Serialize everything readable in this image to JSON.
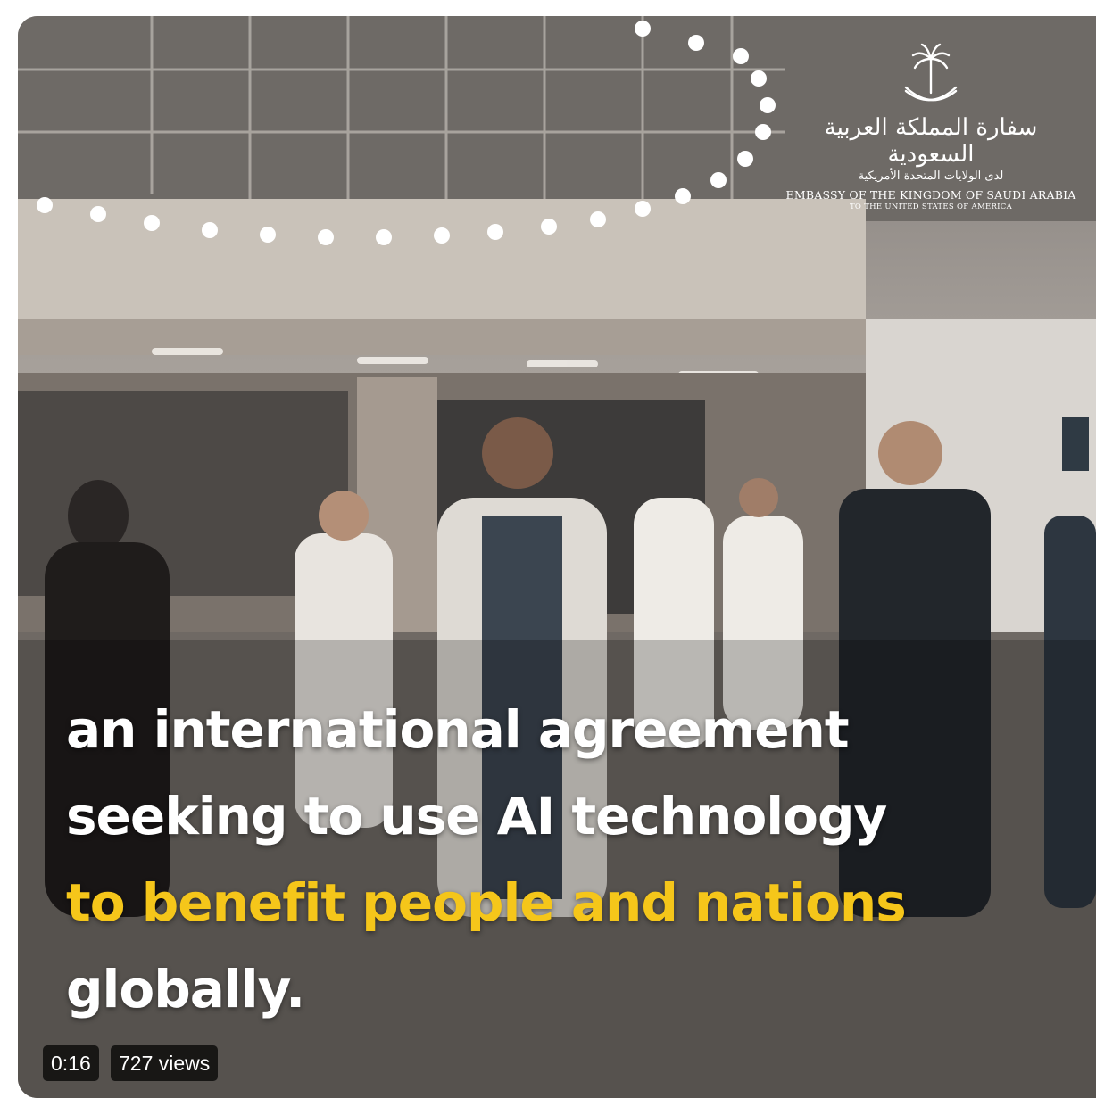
{
  "video": {
    "caption_lines": [
      {
        "text": "an international agreement",
        "color": "white"
      },
      {
        "text": "seeking to use AI technology",
        "color": "white"
      },
      {
        "text": "to benefit people and nations",
        "color": "yellow"
      },
      {
        "text": "globally.",
        "color": "white"
      }
    ],
    "timestamp": "0:16",
    "views": "727 views"
  },
  "logo": {
    "icon": "palm-swords-emblem-icon",
    "arabic_title": "سفارة المملكة العربية السعودية",
    "arabic_subtitle": "لدى الولايات المتحدة الأمريكية",
    "english_title": "EMBASSY OF THE KINGDOM OF SAUDI ARABIA",
    "english_subtitle": "TO THE UNITED STATES OF AMERICA"
  },
  "colors": {
    "caption_white": "#ffffff",
    "caption_yellow": "#f5c61a",
    "chip_background": "#000000"
  }
}
